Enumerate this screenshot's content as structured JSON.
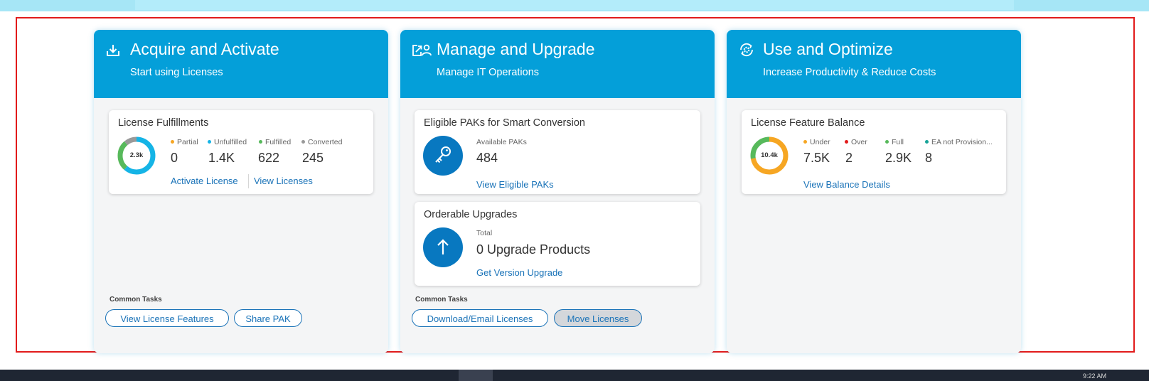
{
  "colors": {
    "header_blue": "#049fd9",
    "link_blue": "#1a73b8",
    "partial": "#f6a623",
    "unfulfilled": "#15b4e6",
    "fulfilled": "#57b95b",
    "converted": "#999999",
    "under": "#f6a623",
    "over": "#e21b1b",
    "full": "#57b95b",
    "ea_not_provisioned": "#17a398",
    "red_frame": "#e21b1b"
  },
  "taskbar": {
    "clock": "9:22 AM"
  },
  "acquire": {
    "icon": "download-tray-icon",
    "title": "Acquire and Activate",
    "subtitle": "Start using Licenses",
    "fulfillments": {
      "title": "License Fulfillments",
      "donut_total": "2.3k",
      "segments": [
        {
          "name": "Partial",
          "value": 0
        },
        {
          "name": "Unfulfilled",
          "value": 1400
        },
        {
          "name": "Fulfilled",
          "value": 622
        },
        {
          "name": "Converted",
          "value": 245
        }
      ],
      "partial_label": "Partial",
      "partial_value": "0",
      "unfulfilled_label": "Unfulfilled",
      "unfulfilled_value": "1.4K",
      "fulfilled_label": "Fulfilled",
      "fulfilled_value": "622",
      "converted_label": "Converted",
      "converted_value": "245",
      "activate_link": "Activate License",
      "view_link": "View Licenses"
    },
    "common_tasks_label": "Common Tasks",
    "btn_view_features": "View License Features",
    "btn_share_pak": "Share PAK"
  },
  "manage": {
    "icon": "share-person-icon",
    "title": "Manage and Upgrade",
    "subtitle": "Manage IT Operations",
    "paks": {
      "title": "Eligible PAKs for Smart Conversion",
      "icon": "key-icon",
      "label": "Available PAKs",
      "value": "484",
      "link": "View Eligible PAKs"
    },
    "upgrades": {
      "title": "Orderable Upgrades",
      "icon": "arrow-up-icon",
      "label": "Total",
      "value": "0 Upgrade Products",
      "link": "Get Version Upgrade"
    },
    "common_tasks_label": "Common Tasks",
    "btn_download": "Download/Email Licenses",
    "btn_move": "Move Licenses"
  },
  "optimize": {
    "icon": "gear-refresh-icon",
    "title": "Use and Optimize",
    "subtitle": "Increase Productivity & Reduce Costs",
    "balance": {
      "title": "License Feature Balance",
      "donut_total": "10.4k",
      "segments": [
        {
          "name": "Under",
          "value": 7500
        },
        {
          "name": "Over",
          "value": 2
        },
        {
          "name": "Full",
          "value": 2900
        },
        {
          "name": "EA not Provision...",
          "value": 8
        }
      ],
      "under_label": "Under",
      "under_value": "7.5K",
      "over_label": "Over",
      "over_value": "2",
      "full_label": "Full",
      "full_value": "2.9K",
      "ea_label": "EA not Provision...",
      "ea_value": "8",
      "link": "View Balance Details"
    }
  }
}
